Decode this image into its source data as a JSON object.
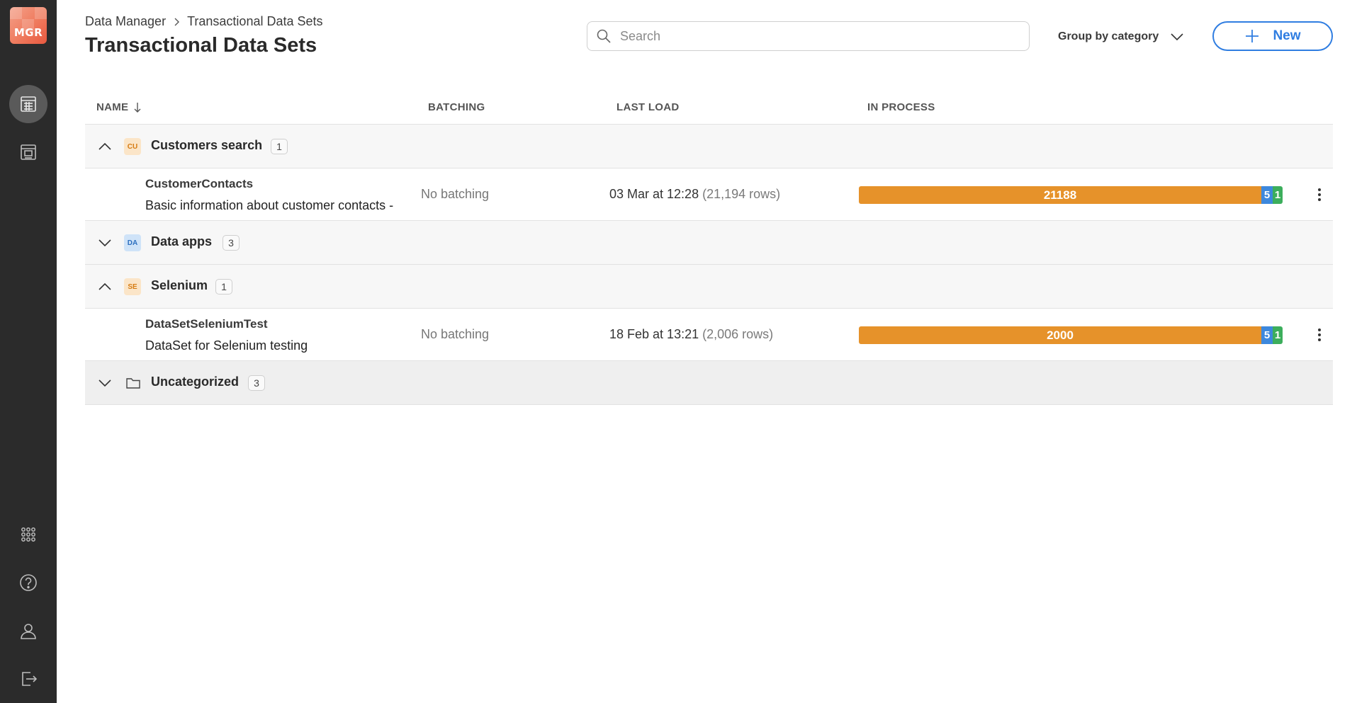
{
  "app": {
    "logo_text": "MGR"
  },
  "sidebar": {
    "items": [
      {
        "icon": "data-sets-icon",
        "active": true
      },
      {
        "icon": "reports-icon",
        "active": false
      },
      {
        "icon": "apps-grid-icon",
        "active": false
      },
      {
        "icon": "help-icon",
        "active": false
      },
      {
        "icon": "user-icon",
        "active": false
      },
      {
        "icon": "logout-icon",
        "active": false
      }
    ]
  },
  "header": {
    "breadcrumb": [
      "Data Manager",
      "Transactional Data Sets"
    ],
    "title": "Transactional Data Sets",
    "search_placeholder": "Search",
    "group_by_label": "Group by category",
    "new_label": "New"
  },
  "table": {
    "columns": [
      "NAME",
      "BATCHING",
      "LAST LOAD",
      "IN PROCESS"
    ],
    "sort_column": "NAME",
    "sort_direction": "descending"
  },
  "groups": [
    {
      "badge": "CU",
      "name": "Customers search",
      "count": "1",
      "expanded": true,
      "rows": [
        {
          "name": "CustomerContacts",
          "description": "Basic information about customer contacts -",
          "batching": "No batching",
          "last_load": "03 Mar at 12:28",
          "rows_text": "(21,194 rows)",
          "in_process": "21188",
          "queued": "5",
          "done": "1"
        }
      ]
    },
    {
      "badge": "DA",
      "name": "Data apps",
      "count": "3",
      "expanded": false,
      "rows": []
    },
    {
      "badge": "SE",
      "name": "Selenium",
      "count": "1",
      "expanded": true,
      "rows": [
        {
          "name": "DataSetSeleniumTest",
          "description": "DataSet for Selenium testing",
          "batching": "No batching",
          "last_load": "18 Feb at 13:21",
          "rows_text": "(2,006 rows)",
          "in_process": "2000",
          "queued": "5",
          "done": "1"
        }
      ]
    },
    {
      "badge": "",
      "name": "Uncategorized",
      "count": "3",
      "expanded": false,
      "rows": []
    }
  ],
  "colors": {
    "accent": "#2f7de1",
    "progress_main": "#e6922a",
    "progress_blue": "#3d88dd",
    "progress_green": "#3cae5c",
    "sidebar_bg": "#2b2b2b"
  }
}
